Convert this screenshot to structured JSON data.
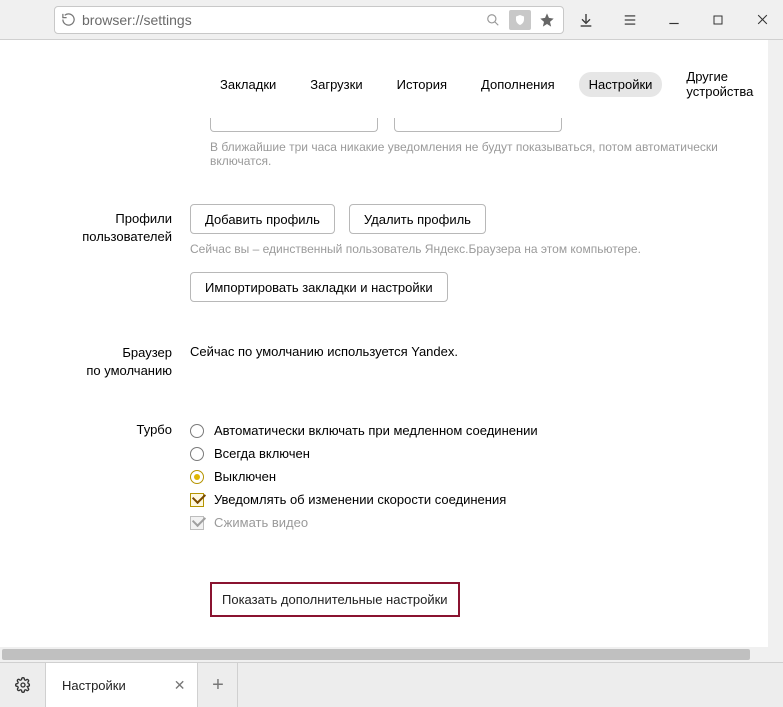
{
  "address_bar": {
    "url": "browser://settings"
  },
  "tabs": {
    "items": [
      "Закладки",
      "Загрузки",
      "История",
      "Дополнения",
      "Настройки",
      "Другие устройства"
    ],
    "active_index": 4
  },
  "notifications": {
    "hint": "В ближайшие три часа никакие уведомления не будут показываться, потом автоматически включатся."
  },
  "profiles": {
    "label_line1": "Профили",
    "label_line2": "пользователей",
    "add_btn": "Добавить профиль",
    "remove_btn": "Удалить профиль",
    "hint": "Сейчас вы – единственный пользователь Яндекс.Браузера на этом компьютере.",
    "import_btn": "Импортировать закладки и настройки"
  },
  "default_browser": {
    "label_line1": "Браузер",
    "label_line2": "по умолчанию",
    "text": "Сейчас по умолчанию используется Yandex."
  },
  "turbo": {
    "label": "Турбо",
    "opts": {
      "auto": "Автоматически включать при медленном соединении",
      "on": "Всегда включен",
      "off": "Выключен"
    },
    "selected": "off",
    "notify_label": "Уведомлять об изменении скорости соединения",
    "notify_checked": true,
    "compress_label": "Сжимать видео",
    "compress_checked": true,
    "compress_disabled": true
  },
  "show_more": "Показать дополнительные настройки",
  "bottom_tab": {
    "title": "Настройки"
  }
}
